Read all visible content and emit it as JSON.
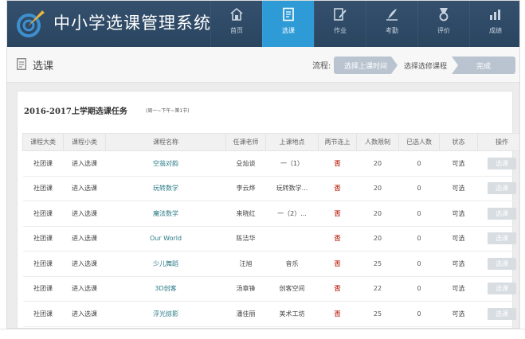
{
  "app": {
    "title": "中小学选课管理系统"
  },
  "nav": [
    {
      "label": "首页",
      "icon": "home-icon",
      "active": false
    },
    {
      "label": "选课",
      "icon": "document-icon",
      "active": true
    },
    {
      "label": "作业",
      "icon": "pencil-paper-icon",
      "active": false
    },
    {
      "label": "考勤",
      "icon": "quill-icon",
      "active": false
    },
    {
      "label": "评价",
      "icon": "medal-icon",
      "active": false
    },
    {
      "label": "成绩",
      "icon": "chart-icon",
      "active": false
    }
  ],
  "page": {
    "title": "选课",
    "icon": "page-icon"
  },
  "flow": {
    "label": "流程:",
    "steps": [
      "选择上课时间",
      "选择选修课程",
      "完成"
    ],
    "current_step": 2
  },
  "term": {
    "title": "2016-2017上学期选课任务",
    "subtitle": "(周一~下午~第1节)"
  },
  "table": {
    "headers": [
      "课程大类",
      "课程小类",
      "课程名称",
      "任课老师",
      "上课地点",
      "两节连上",
      "人数限制",
      "已选人数",
      "状态",
      "操作"
    ],
    "rows": [
      {
        "category": "社团课",
        "subcategory": "进入选课",
        "course": "空翁对韵",
        "teacher": "殳灿谈",
        "location": "一（1）",
        "double": "否",
        "limit": "20",
        "selected": "0",
        "status": "可选",
        "action": "选课"
      },
      {
        "category": "社团课",
        "subcategory": "进入选课",
        "course": "玩转数学",
        "teacher": "李云烨",
        "location": "玩转数学...",
        "double": "否",
        "limit": "20",
        "selected": "0",
        "status": "可选",
        "action": "选课"
      },
      {
        "category": "社团课",
        "subcategory": "进入选课",
        "course": "魔法数学",
        "teacher": "来晓红",
        "location": "一（2）...",
        "double": "否",
        "limit": "20",
        "selected": "0",
        "status": "可选",
        "action": "选课"
      },
      {
        "category": "社团课",
        "subcategory": "进入选课",
        "course": "Our World",
        "teacher": "陈洁华",
        "location": "",
        "double": "否",
        "limit": "20",
        "selected": "0",
        "status": "可选",
        "action": "选课"
      },
      {
        "category": "社团课",
        "subcategory": "进入选课",
        "course": "少儿舞蹈",
        "teacher": "汪旭",
        "location": "音乐",
        "double": "否",
        "limit": "25",
        "selected": "0",
        "status": "可选",
        "action": "选课"
      },
      {
        "category": "社团课",
        "subcategory": "进入选课",
        "course": "3D创客",
        "teacher": "汤章锋",
        "location": "创客空间",
        "double": "否",
        "limit": "22",
        "selected": "0",
        "status": "可选",
        "action": "选课"
      },
      {
        "category": "社团课",
        "subcategory": "进入选课",
        "course": "浮光掠影",
        "teacher": "潘佳丽",
        "location": "美术工坊",
        "double": "否",
        "limit": "25",
        "selected": "0",
        "status": "可选",
        "action": "选课"
      }
    ]
  },
  "colors": {
    "header_bg": "#2f4a66",
    "active_tab": "#2e9bd7",
    "no_text": "#c0392b",
    "course_text": "#2a7a86"
  }
}
